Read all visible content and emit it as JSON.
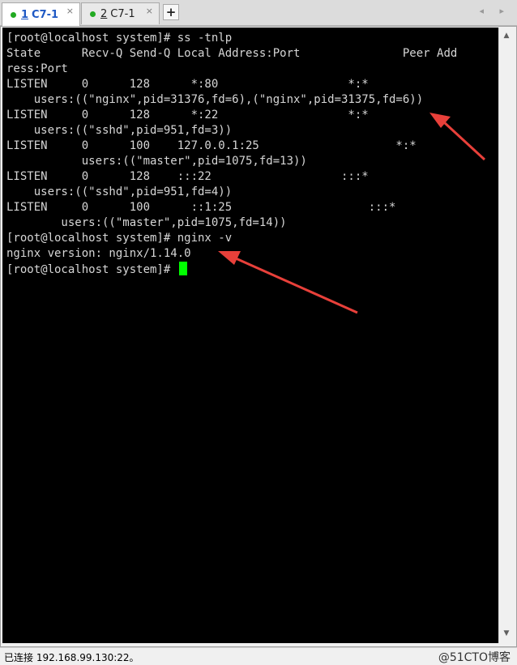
{
  "tabs": [
    {
      "number": "1",
      "label": "C7-1",
      "status_color": "#22aa22",
      "active": true,
      "close": "×"
    },
    {
      "number": "2",
      "label": "C7-1",
      "status_color": "#22aa22",
      "active": false,
      "close": "×"
    }
  ],
  "new_tab_label": "+",
  "nav_arrows": "◂ ▸",
  "terminal": {
    "background": "#000000",
    "foreground": "#d6d6d6",
    "cursor_color": "#00ff00",
    "lines": [
      "[root@localhost system]# ss -tnlp",
      "State      Recv-Q Send-Q Local Address:Port               Peer Add",
      "ress:Port",
      "LISTEN     0      128      *:80                   *:*",
      "    users:((\"nginx\",pid=31376,fd=6),(\"nginx\",pid=31375,fd=6))",
      "LISTEN     0      128      *:22                   *:*",
      "    users:((\"sshd\",pid=951,fd=3))",
      "LISTEN     0      100    127.0.0.1:25                    *:*",
      "           users:((\"master\",pid=1075,fd=13))",
      "LISTEN     0      128    :::22                   :::*",
      "    users:((\"sshd\",pid=951,fd=4))",
      "LISTEN     0      100      ::1:25                    :::*",
      "        users:((\"master\",pid=1075,fd=14))",
      "[root@localhost system]# nginx -v",
      "nginx version: nginx/1.14.0",
      "[root@localhost system]# "
    ]
  },
  "annotation_color": "#e8403a",
  "scrollbar": {
    "up": "▲",
    "down": "▼"
  },
  "statusbar": {
    "text": "已连接 192.168.99.130:22。",
    "watermark": "@51CTO博客"
  }
}
